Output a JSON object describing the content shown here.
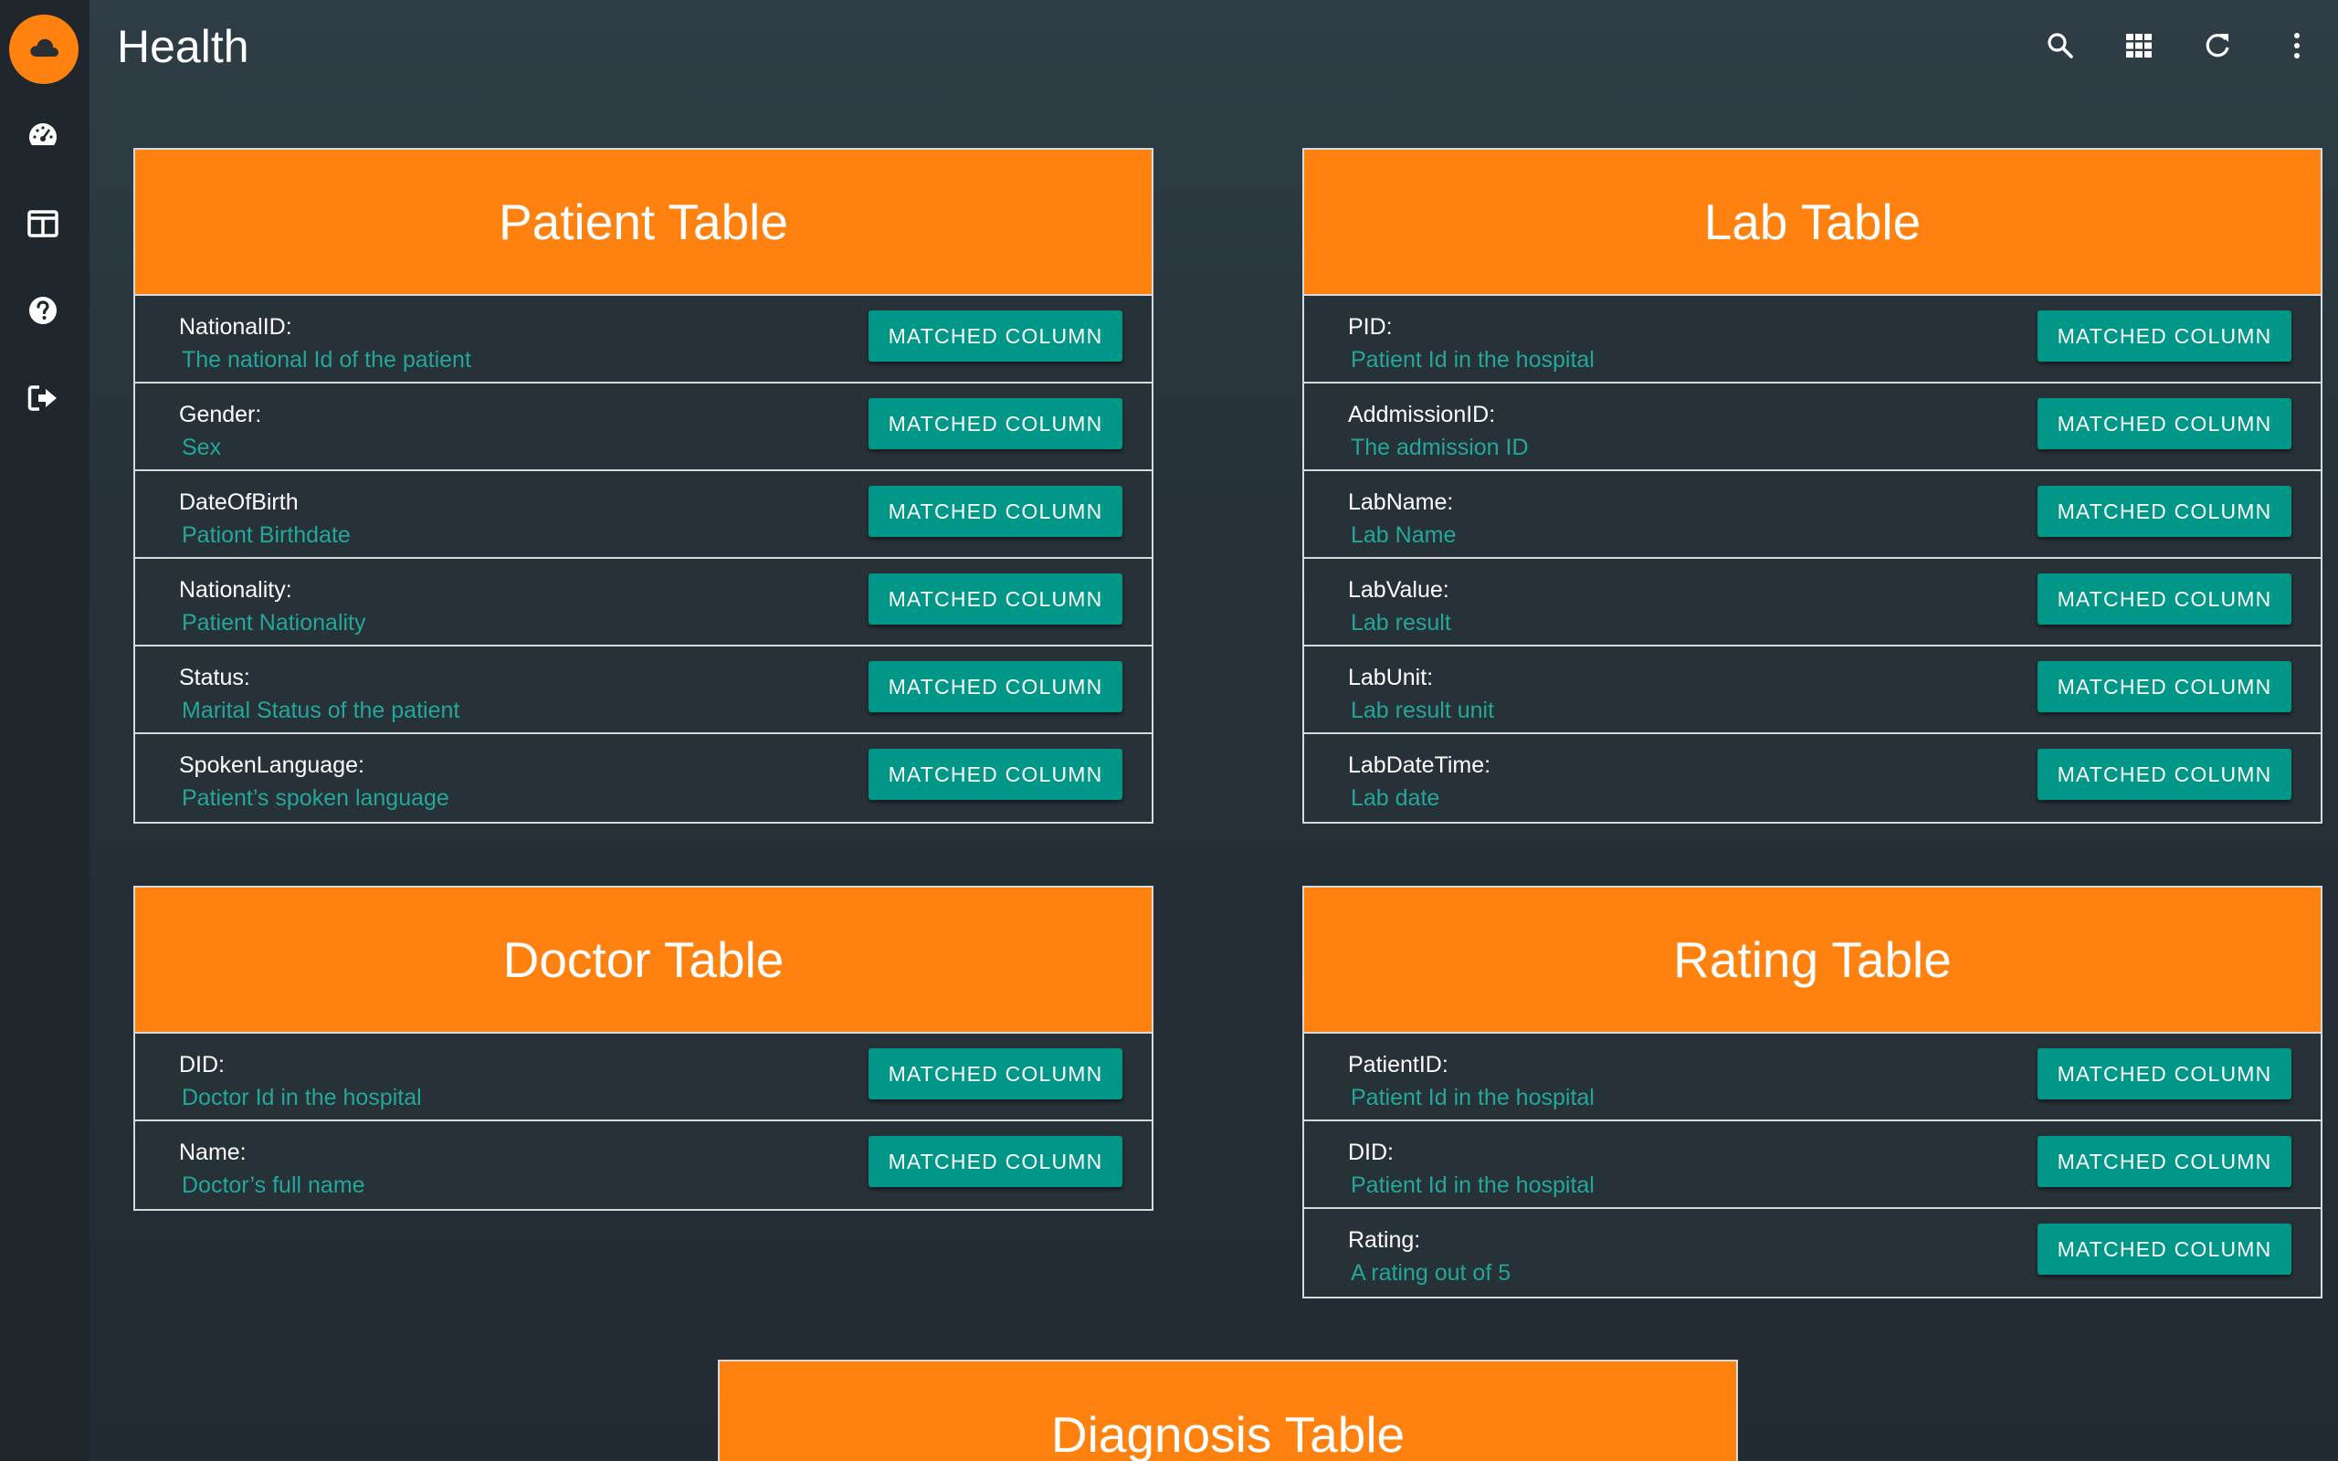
{
  "header": {
    "title": "Health"
  },
  "sidebar": {
    "logo_icon": "cloud-icon",
    "items": [
      {
        "icon": "dashboard-icon"
      },
      {
        "icon": "table-layout-icon"
      },
      {
        "icon": "help-icon"
      },
      {
        "icon": "logout-icon"
      }
    ]
  },
  "toolbar": {
    "icons": [
      "search-icon",
      "apps-grid-icon",
      "refresh-icon",
      "more-vert-icon"
    ]
  },
  "colors": {
    "accent": "#ff8210",
    "button": "#009688",
    "description": "#26a69a",
    "background": "#263238"
  },
  "tables": [
    {
      "title": "Patient Table",
      "rows": [
        {
          "name": "NationalID:",
          "desc": "The national Id of the patient",
          "button": "MATCHED COLUMN"
        },
        {
          "name": "Gender:",
          "desc": "Sex",
          "button": "MATCHED COLUMN"
        },
        {
          "name": "DateOfBirth",
          "desc": "Pationt Birthdate",
          "button": "MATCHED COLUMN"
        },
        {
          "name": "Nationality:",
          "desc": "Patient Nationality",
          "button": "MATCHED COLUMN"
        },
        {
          "name": "Status:",
          "desc": "Marital Status of the patient",
          "button": "MATCHED COLUMN"
        },
        {
          "name": "SpokenLanguage:",
          "desc": "Patient’s spoken language",
          "button": "MATCHED COLUMN"
        }
      ]
    },
    {
      "title": "Lab Table",
      "rows": [
        {
          "name": "PID:",
          "desc": "Patient Id in the hospital",
          "button": "MATCHED COLUMN"
        },
        {
          "name": "AddmissionID:",
          "desc": "The admission ID",
          "button": "MATCHED COLUMN"
        },
        {
          "name": "LabName:",
          "desc": "Lab Name",
          "button": "MATCHED COLUMN"
        },
        {
          "name": "LabValue:",
          "desc": "Lab result",
          "button": "MATCHED COLUMN"
        },
        {
          "name": "LabUnit:",
          "desc": "Lab result unit",
          "button": "MATCHED COLUMN"
        },
        {
          "name": "LabDateTime:",
          "desc": "Lab date",
          "button": "MATCHED COLUMN"
        }
      ]
    },
    {
      "title": "Doctor Table",
      "rows": [
        {
          "name": "DID:",
          "desc": "Doctor Id in the hospital",
          "button": "MATCHED COLUMN"
        },
        {
          "name": "Name:",
          "desc": "Doctor’s full name",
          "button": "MATCHED COLUMN"
        }
      ]
    },
    {
      "title": "Rating Table",
      "rows": [
        {
          "name": "PatientID:",
          "desc": "Patient Id in the hospital",
          "button": "MATCHED COLUMN"
        },
        {
          "name": "DID:",
          "desc": "Patient Id in the hospital",
          "button": "MATCHED COLUMN"
        },
        {
          "name": "Rating:",
          "desc": "A rating out of 5",
          "button": "MATCHED COLUMN"
        }
      ]
    },
    {
      "title": "Diagnosis Table",
      "rows": []
    }
  ]
}
